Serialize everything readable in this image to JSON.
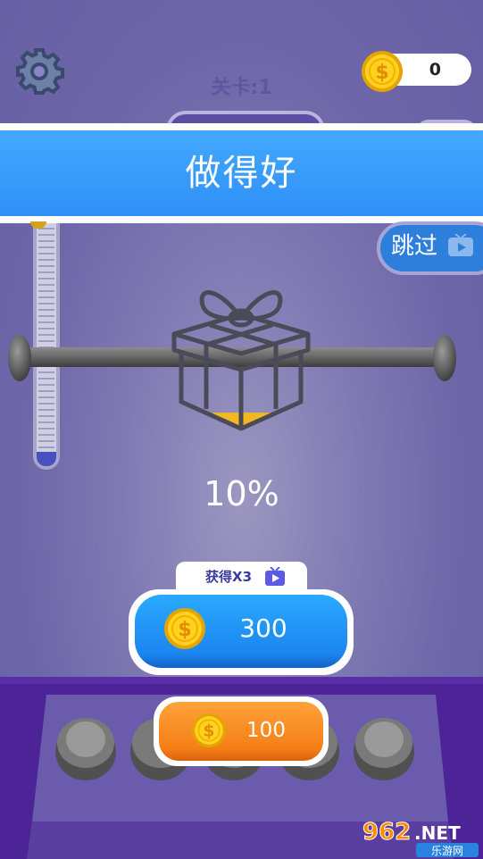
{
  "header": {
    "level_label": "关卡:1",
    "coins": "0"
  },
  "banner": {
    "text": "做得好"
  },
  "skip": {
    "label": "跳过"
  },
  "progress": {
    "percent_text": "10%",
    "fill_fraction": 0.1
  },
  "reward": {
    "tag_label": "获得X3",
    "coins": "300"
  },
  "claim": {
    "coins": "100"
  },
  "watermark": {
    "text": "962.NET",
    "subtext": "乐游网"
  },
  "colors": {
    "banner": "#2f8ff7",
    "reward_button": "#1b86f0",
    "claim_button": "#f57e16",
    "coin": "#ffc21a",
    "bottom_panel": "#4d2398"
  }
}
